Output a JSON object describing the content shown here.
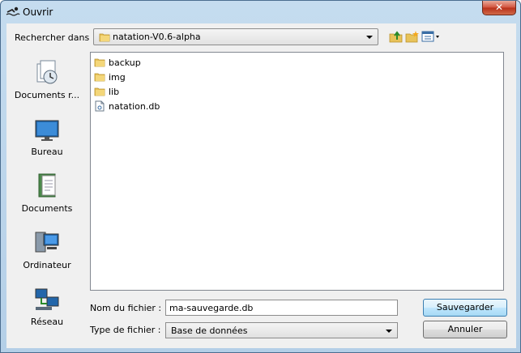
{
  "window": {
    "title": "Ouvrir",
    "close_label": "✕"
  },
  "toolbar": {
    "lookin_label": "Rechercher dans :",
    "lookin_value": "natation-V0.6-alpha",
    "icons": [
      "up-folder-icon",
      "new-folder-icon",
      "view-menu-icon"
    ]
  },
  "places": [
    {
      "label": "Documents r...",
      "icon": "recent-documents-icon"
    },
    {
      "label": "Bureau",
      "icon": "desktop-icon"
    },
    {
      "label": "Documents",
      "icon": "documents-icon"
    },
    {
      "label": "Ordinateur",
      "icon": "computer-icon"
    },
    {
      "label": "Réseau",
      "icon": "network-icon"
    }
  ],
  "files": [
    {
      "name": "backup",
      "type": "folder"
    },
    {
      "name": "img",
      "type": "folder"
    },
    {
      "name": "lib",
      "type": "folder"
    },
    {
      "name": "natation.db",
      "type": "file"
    }
  ],
  "form": {
    "filename_label": "Nom du fichier :",
    "filename_value": "ma-sauvegarde.db",
    "filetype_label": "Type de fichier :",
    "filetype_value": "Base de données"
  },
  "buttons": {
    "save": "Sauvegarder",
    "cancel": "Annuler"
  }
}
